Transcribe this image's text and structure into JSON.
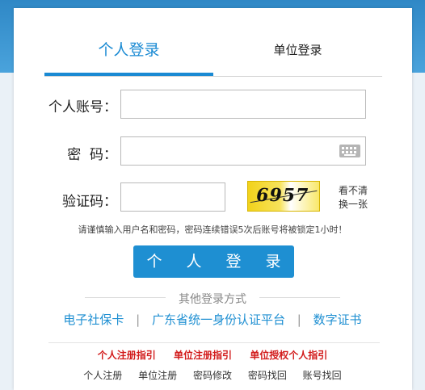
{
  "tabs": {
    "personal": "个人登录",
    "unit": "单位登录"
  },
  "form": {
    "account_label": "个人账号：",
    "password_label": "密  码：",
    "captcha_label": "验证码：",
    "account_value": "",
    "password_value": "",
    "captcha_value": "",
    "captcha_image_text": "6957",
    "captcha_refresh": "看不清换一张",
    "keyboard_icon": "keyboard-icon"
  },
  "warning": "请谨慎输入用户名和密码，密码连续错误5次后账号将被锁定1小时！",
  "login_button": "个 人 登 录",
  "other_login": {
    "title": "其他登录方式",
    "links": [
      "电子社保卡",
      "广东省统一身份认证平台",
      "数字证书"
    ],
    "separator": "|"
  },
  "guides": [
    "个人注册指引",
    "单位注册指引",
    "单位授权个人指引"
  ],
  "bottom_links": [
    "个人注册",
    "单位注册",
    "密码修改",
    "密码找回",
    "账号找回"
  ],
  "colors": {
    "accent": "#1e8fd2",
    "guide_red": "#d21b1b"
  }
}
